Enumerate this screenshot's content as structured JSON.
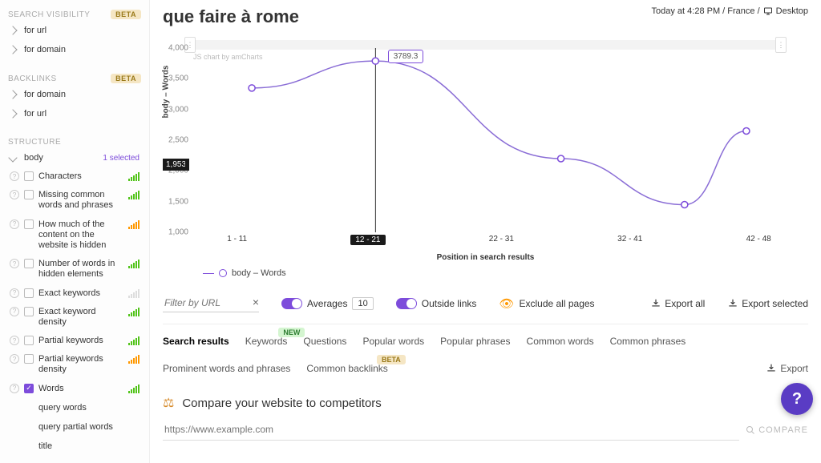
{
  "sidebar": {
    "visibility": {
      "title": "SEARCH VISIBILITY",
      "badge": "BETA",
      "items": [
        "for url",
        "for domain"
      ]
    },
    "backlinks": {
      "title": "BACKLINKS",
      "badge": "BETA",
      "items": [
        "for domain",
        "for url"
      ]
    },
    "structure": {
      "title": "STRUCTURE",
      "body_label": "body",
      "selected": "1 selected",
      "metrics": [
        {
          "label": "Characters",
          "bars": "green"
        },
        {
          "label": "Missing common words and phrases",
          "bars": "green"
        },
        {
          "label": "How much of the content on the website is hidden",
          "bars": "orange"
        },
        {
          "label": "Number of words in hidden elements",
          "bars": "green"
        },
        {
          "label": "Exact keywords",
          "bars": "faded"
        },
        {
          "label": "Exact keyword density",
          "bars": "green"
        },
        {
          "label": "Partial keywords",
          "bars": "green"
        },
        {
          "label": "Partial keywords density",
          "bars": "orange"
        },
        {
          "label": "Words",
          "bars": "green",
          "checked": true
        }
      ],
      "children": [
        "query words",
        "query partial words",
        "title"
      ]
    }
  },
  "header": {
    "title": "que faire à rome",
    "context": "Today at 4:28 PM / France /",
    "device": "Desktop"
  },
  "chart_data": {
    "type": "line",
    "categories": [
      "1 - 11",
      "12 - 21",
      "22 - 31",
      "32 - 41",
      "42 - 48"
    ],
    "values": [
      3350,
      3789.3,
      2200,
      1450,
      2650
    ],
    "title": "",
    "xlabel": "Position in search results",
    "ylabel": "body – Words",
    "ylim": [
      1000,
      4000
    ],
    "yticks": [
      1000,
      1500,
      2000,
      2500,
      3000,
      3500,
      4000
    ],
    "highlighted_category": "12 - 21",
    "tooltip_value": "3789.3",
    "y_callout": "1,953",
    "credit": "JS chart by amCharts",
    "legend": "body – Words"
  },
  "controls": {
    "filter_placeholder": "Filter by URL",
    "averages_label": "Averages",
    "averages_value": "10",
    "outside_label": "Outside links",
    "exclude_label": "Exclude all pages",
    "export_all": "Export all",
    "export_selected": "Export selected"
  },
  "tabs": {
    "items": [
      {
        "label": "Search results",
        "active": true
      },
      {
        "label": "Keywords",
        "badge": "NEW"
      },
      {
        "label": "Questions"
      },
      {
        "label": "Popular words"
      },
      {
        "label": "Popular phrases"
      },
      {
        "label": "Common words"
      },
      {
        "label": "Common phrases"
      },
      {
        "label": "Prominent words and phrases"
      },
      {
        "label": "Common backlinks",
        "badge": "BETA"
      }
    ],
    "export": "Export"
  },
  "compare": {
    "heading": "Compare your website to competitors",
    "placeholder": "https://www.example.com",
    "button": "COMPARE"
  }
}
